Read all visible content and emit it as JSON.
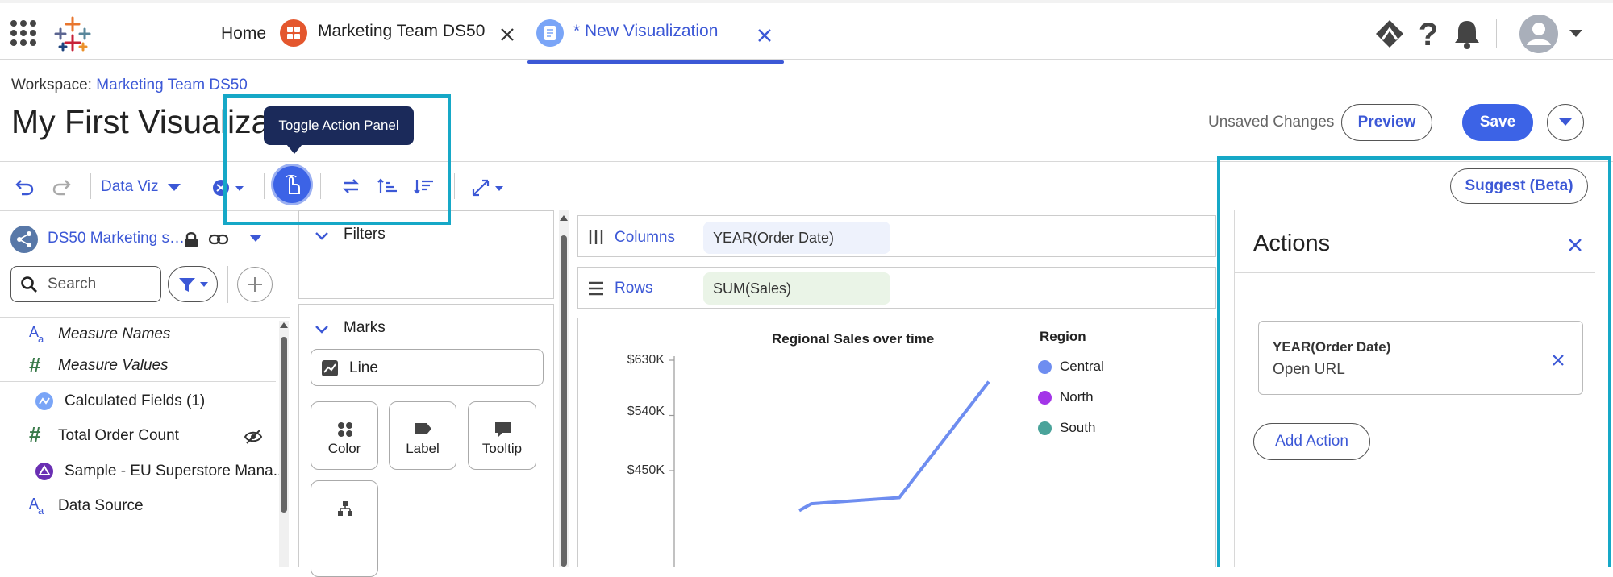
{
  "nav": {
    "home": "Home",
    "tab1": "Marketing Team DS50",
    "tab2": "* New Visualization"
  },
  "header": {
    "workspace_label": "Workspace:",
    "workspace_name": "Marketing Team DS50",
    "title": "My First Visualizat",
    "unsaved": "Unsaved Changes",
    "preview": "Preview",
    "save": "Save"
  },
  "toolbar": {
    "dataviz": "Data Viz",
    "tooltip": "Toggle Action Panel",
    "suggest": "Suggest (Beta)"
  },
  "left_panel": {
    "datasource": "DS50 Marketing s…",
    "search_placeholder": "Search",
    "fields": [
      {
        "label": "Measure Names"
      },
      {
        "label": "Measure Values"
      },
      {
        "label": "Calculated Fields (1)"
      },
      {
        "label": "Total Order Count"
      },
      {
        "label": "Sample - EU Superstore Mana..."
      },
      {
        "label": "Data Source"
      }
    ]
  },
  "middle": {
    "filters": "Filters",
    "marks": "Marks",
    "mark_type": "Line",
    "cards": [
      {
        "label": "Color"
      },
      {
        "label": "Label"
      },
      {
        "label": "Tooltip"
      }
    ]
  },
  "shelves": {
    "columns_label": "Columns",
    "columns_pill": "YEAR(Order Date)",
    "rows_label": "Rows",
    "rows_pill": "SUM(Sales)"
  },
  "chart_data": {
    "type": "line",
    "title": "Regional Sales over time",
    "y_ticks": [
      "$630K",
      "$540K",
      "$450K"
    ],
    "y_tick_values": [
      630,
      540,
      450
    ],
    "legend_title": "Region",
    "series": [
      {
        "name": "Central",
        "color": "#6e8df0"
      },
      {
        "name": "North",
        "color": "#a335e8"
      },
      {
        "name": "South",
        "color": "#4aa39a"
      }
    ],
    "visible_line": {
      "series": "Central",
      "values_k": [
        385,
        396,
        406,
        595
      ]
    }
  },
  "actions": {
    "title": "Actions",
    "items": [
      {
        "field": "YEAR(Order Date)",
        "type": "Open URL"
      }
    ],
    "add_action": "Add Action"
  },
  "colors": {
    "accent": "#3c58d6",
    "highlight": "#16a8c7"
  }
}
